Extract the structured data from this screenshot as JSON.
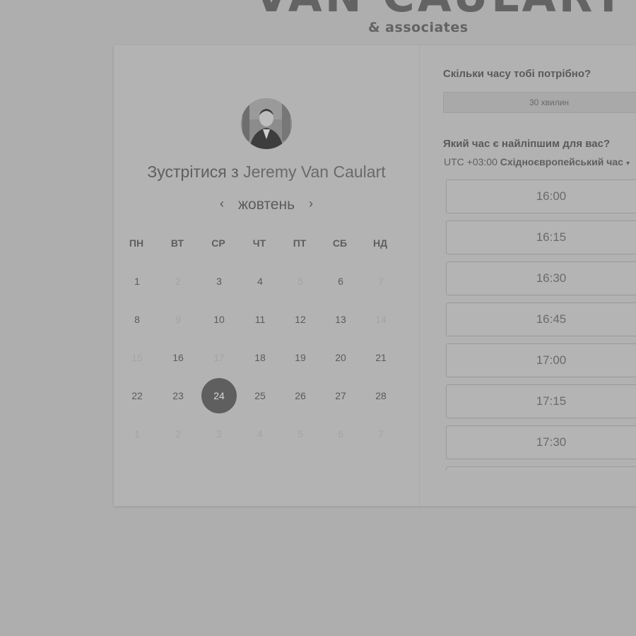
{
  "brand": {
    "name": "VAN CAULART",
    "subtitle": "& associates"
  },
  "scheduler": {
    "meet_prefix": "Зустрітися з",
    "host_name": "Jeremy Van Caulart",
    "month": "жовтень",
    "prev_icon": "chevron-left-icon",
    "next_icon": "chevron-right-icon",
    "weekdays": [
      "ПН",
      "ВТ",
      "СР",
      "ЧТ",
      "ПТ",
      "СБ",
      "НД"
    ],
    "weeks": [
      [
        "1",
        "2",
        "3",
        "4",
        "5",
        "6",
        "7"
      ],
      [
        "8",
        "9",
        "10",
        "11",
        "12",
        "13",
        "14"
      ],
      [
        "15",
        "16",
        "17",
        "18",
        "19",
        "20",
        "21"
      ],
      [
        "22",
        "23",
        "24",
        "25",
        "26",
        "27",
        "28"
      ],
      [
        "1",
        "2",
        "3",
        "4",
        "5",
        "6",
        "7"
      ]
    ],
    "disabled_days": [
      "2",
      "5",
      "7",
      "9",
      "14",
      "15",
      "17"
    ],
    "selected_day": "24"
  },
  "booking": {
    "duration_question": "Скільки часу тобі потрібно?",
    "duration_value": "30 хвилин",
    "time_question": "Який час є найліпшим для вас?",
    "timezone_offset": "UTC +03:00",
    "timezone_name": "Східноєвропейський час",
    "slots": [
      "16:00",
      "16:15",
      "16:30",
      "16:45",
      "17:00",
      "17:15",
      "17:30",
      ""
    ]
  },
  "colors": {
    "selected_day": "#5f5f5f",
    "background": "#aeaeae",
    "card": "#b3b3b3"
  }
}
